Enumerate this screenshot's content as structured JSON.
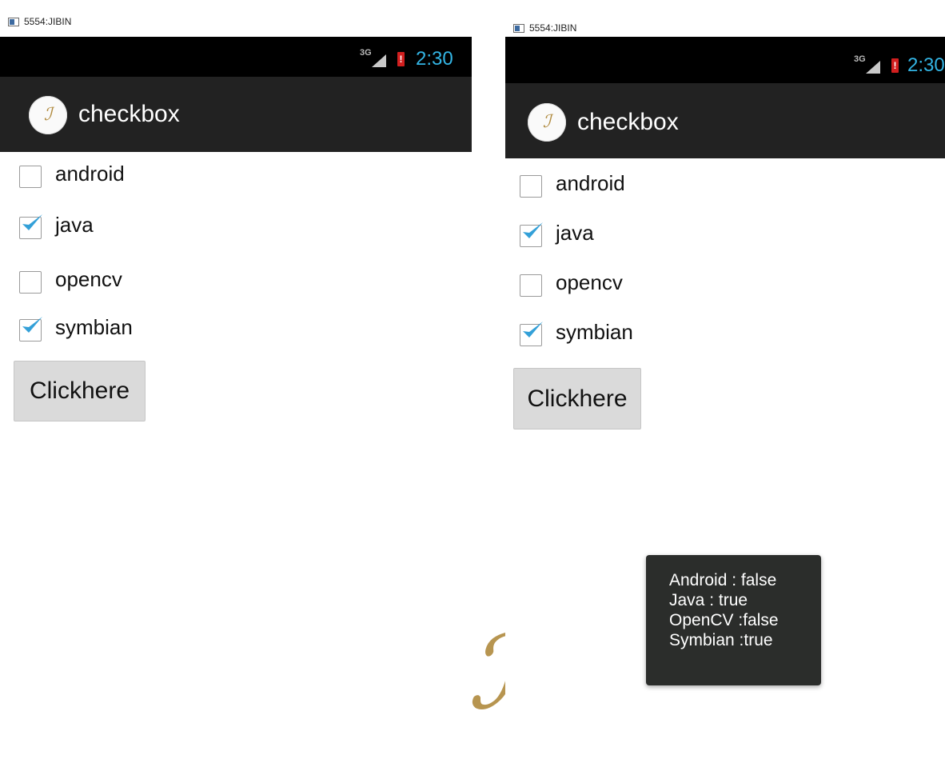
{
  "window": {
    "title": "5554:JIBIN"
  },
  "status": {
    "network": "3G",
    "battery_alert": "!",
    "time": "2:30"
  },
  "app": {
    "title": "checkbox",
    "icon": "app-logo-icon"
  },
  "checkboxes": [
    {
      "label": "android",
      "checked": false
    },
    {
      "label": "java",
      "checked": true
    },
    {
      "label": "opencv",
      "checked": false
    },
    {
      "label": "symbian",
      "checked": true
    }
  ],
  "button": {
    "label": "Clickhere"
  },
  "toast": {
    "lines": [
      "Android : false",
      "Java : true",
      "OpenCV :false",
      "Symbian :true"
    ]
  },
  "colors": {
    "accent": "#33b5e5",
    "actionbar": "#222222",
    "statusbar": "#000000",
    "toast": "#2b2d2b"
  }
}
